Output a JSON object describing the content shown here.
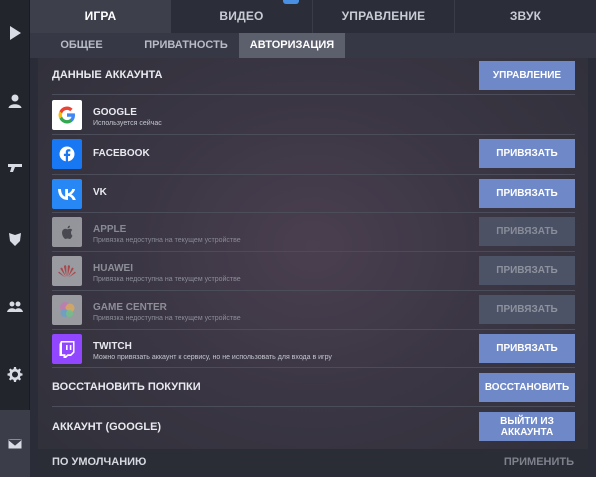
{
  "rail": {
    "items": [
      {
        "icon": "play-icon"
      },
      {
        "icon": "profile-icon"
      },
      {
        "icon": "weapon-icon"
      },
      {
        "icon": "clan-shield-icon"
      },
      {
        "icon": "friends-icon"
      },
      {
        "icon": "gear-icon",
        "active": true
      },
      {
        "icon": "mail-icon"
      }
    ]
  },
  "top_tabs": [
    {
      "label": "ИГРА",
      "active": true
    },
    {
      "label": "ВИДЕО"
    },
    {
      "label": "УПРАВЛЕНИЕ"
    },
    {
      "label": "ЗВУК"
    }
  ],
  "sub_tabs": [
    {
      "label": "ОБЩЕЕ"
    },
    {
      "label": "ПРИВАТНОСТЬ"
    },
    {
      "label": "АВТОРИЗАЦИЯ",
      "active": true
    }
  ],
  "account": {
    "header_label": "ДАННЫЕ АККАУНТА",
    "manage_button": "УПРАВЛЕНИЕ",
    "providers": [
      {
        "name": "GOOGLE",
        "status": "Используется сейчас",
        "button": "",
        "enabled": true,
        "icon": "google-icon",
        "color": "#ffffff"
      },
      {
        "name": "FACEBOOK",
        "status": "",
        "button": "ПРИВЯЗАТЬ",
        "enabled": true,
        "icon": "facebook-icon",
        "color": "#1877f2"
      },
      {
        "name": "VK",
        "status": "",
        "button": "ПРИВЯЗАТЬ",
        "enabled": true,
        "icon": "vk-icon",
        "color": "#2787f5"
      },
      {
        "name": "APPLE",
        "status": "Привязка недоступна на текущем устройстве",
        "button": "ПРИВЯЗАТЬ",
        "enabled": false,
        "icon": "apple-icon",
        "color": "#ffffff"
      },
      {
        "name": "HUAWEI",
        "status": "Привязка недоступна на текущем устройстве",
        "button": "ПРИВЯЗАТЬ",
        "enabled": false,
        "icon": "huawei-icon",
        "color": "#ffffff"
      },
      {
        "name": "GAME CENTER",
        "status": "Привязка недоступна на текущем устройстве",
        "button": "ПРИВЯЗАТЬ",
        "enabled": false,
        "icon": "game-center-icon",
        "color": "#ffffff"
      },
      {
        "name": "TWITCH",
        "status": "Можно привязать аккаунт к сервису, но не использовать для входа в игру",
        "button": "ПРИВЯЗАТЬ",
        "enabled": true,
        "icon": "twitch-icon",
        "color": "#9146ff"
      }
    ]
  },
  "restore": {
    "label": "ВОССТАНОВИТЬ ПОКУПКИ",
    "button": "ВОССТАНОВИТЬ"
  },
  "logout": {
    "label": "АККАУНТ (GOOGLE)",
    "button": "ВЫЙТИ ИЗ АККАУНТА"
  },
  "footer": {
    "defaults": "ПО УМОЛЧАНИЮ",
    "apply": "ПРИМЕНИТЬ"
  }
}
